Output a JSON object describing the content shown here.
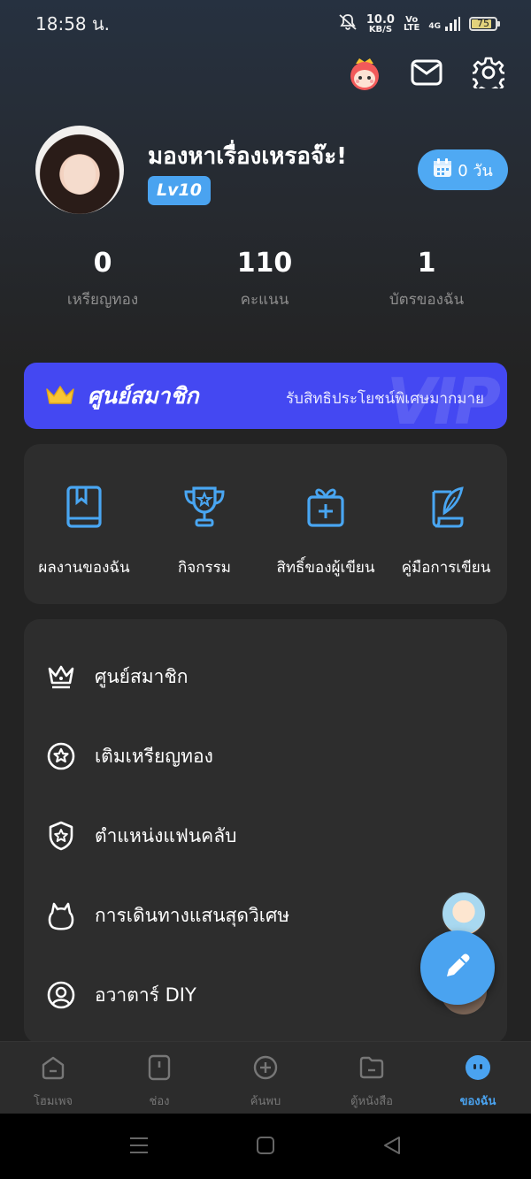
{
  "status": {
    "time": "18:58 น.",
    "net_speed": "10.0",
    "net_unit": "KB/S",
    "volte_top": "Vo",
    "volte_bottom": "LTE",
    "signal": "4G",
    "battery": "75"
  },
  "profile": {
    "username": "มองหาเรื่องเหรอจ๊ะ!",
    "level": "Lv10",
    "checkin_days": "0 วัน"
  },
  "stats": [
    {
      "value": "0",
      "label": "เหรียญทอง"
    },
    {
      "value": "110",
      "label": "คะแนน"
    },
    {
      "value": "1",
      "label": "บัตรของฉัน"
    }
  ],
  "vip": {
    "title": "ศูนย์สมาชิก",
    "subtitle": "รับสิทธิประโยชน์พิเศษมากมาย",
    "watermark": "VIP"
  },
  "actions": [
    {
      "label": "ผลงานของฉัน",
      "icon": "book-icon"
    },
    {
      "label": "กิจกรรม",
      "icon": "trophy-icon"
    },
    {
      "label": "สิทธิ์ของผู้เขียน",
      "icon": "gift-icon"
    },
    {
      "label": "คู่มือการเขียน",
      "icon": "quill-icon"
    }
  ],
  "menu": [
    {
      "label": "ศูนย์สมาชิก",
      "icon": "crown-icon"
    },
    {
      "label": "เติมเหรียญทอง",
      "icon": "coin-star-icon"
    },
    {
      "label": "ตำแหน่งแฟนคลับ",
      "icon": "shield-star-icon"
    },
    {
      "label": "การเดินทางแสนสุดวิเศษ",
      "icon": "cat-icon"
    },
    {
      "label": "อวาตาร์ DIY",
      "icon": "user-circle-icon"
    }
  ],
  "nav": [
    {
      "label": "โฮมเพจ",
      "icon": "home-icon",
      "active": false
    },
    {
      "label": "ช่อง",
      "icon": "channel-icon",
      "active": false
    },
    {
      "label": "ค้นพบ",
      "icon": "discover-icon",
      "active": false
    },
    {
      "label": "ตู้หนังสือ",
      "icon": "folder-icon",
      "active": false
    },
    {
      "label": "ของฉัน",
      "icon": "me-icon",
      "active": true
    }
  ],
  "colors": {
    "accent": "#4aa3f0",
    "vip": "#4448f2",
    "card": "#2d2d2d",
    "background": "#232323"
  }
}
